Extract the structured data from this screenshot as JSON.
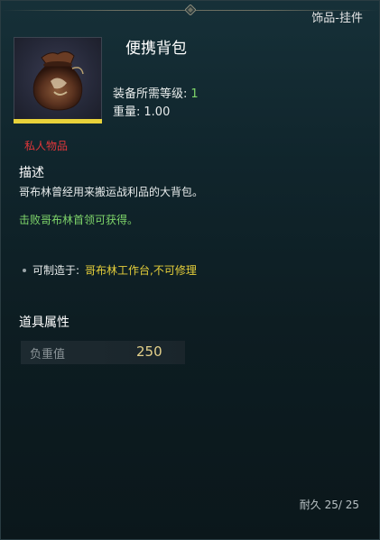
{
  "header": {
    "category": "饰品-挂件"
  },
  "item": {
    "name": "便携背包",
    "icon": "loot-bag-icon",
    "requirement_label": "装备所需等级:",
    "requirement_value": "1",
    "weight_label": "重量:",
    "weight_value": "1.00",
    "binding": "私人物品"
  },
  "description": {
    "title": "描述",
    "text": "哥布林曾经用来搬运战利品的大背包。",
    "source": "击败哥布林首领可获得。"
  },
  "crafting": {
    "label": "可制造于:",
    "value": "哥布林工作台,不可修理"
  },
  "attributes": {
    "title": "道具属性",
    "rows": [
      {
        "label": "负重值",
        "value": "250"
      }
    ]
  },
  "durability": {
    "text": "耐久 25/ 25"
  },
  "colors": {
    "rarity_bar": "#e8d23a",
    "private_red": "#e0363a",
    "green_text": "#7fd66a",
    "craft_yellow": "#e6cf3a",
    "attr_value": "#e3d08a"
  }
}
